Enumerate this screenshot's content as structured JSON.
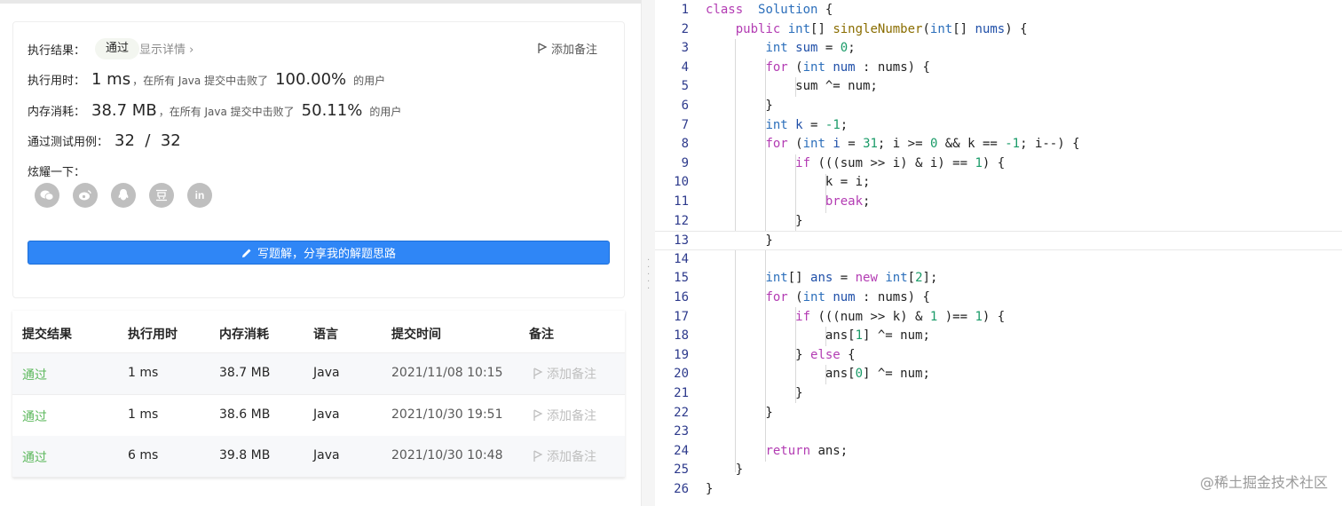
{
  "result": {
    "exec_result_label": "执行结果：",
    "status": "通过",
    "show_details": "显示详情 ›",
    "add_note": "添加备注",
    "time_label": "执行用时：",
    "time_value": "1 ms",
    "time_mid": "，在所有 Java 提交中击败了",
    "time_percent": "100.00%",
    "users_suffix": "的用户",
    "memory_label": "内存消耗：",
    "memory_value": "38.7 MB",
    "memory_mid": "，在所有 Java 提交中击败了",
    "memory_percent": "50.11%",
    "cases_label": "通过测试用例：",
    "cases_value": "32  /  32",
    "share_label": "炫耀一下：",
    "share_icons": [
      "wechat-icon",
      "weibo-icon",
      "qq-icon",
      "douban-icon",
      "linkedin-icon"
    ],
    "write_solution": "写题解，分享我的解题思路"
  },
  "submissions": {
    "headers": [
      "提交结果",
      "执行用时",
      "内存消耗",
      "语言",
      "提交时间",
      "备注"
    ],
    "rows": [
      {
        "status": "通过",
        "time": "1 ms",
        "memory": "38.7 MB",
        "lang": "Java",
        "submitted": "2021/11/08 10:15",
        "note": "添加备注"
      },
      {
        "status": "通过",
        "time": "1 ms",
        "memory": "38.6 MB",
        "lang": "Java",
        "submitted": "2021/10/30 19:51",
        "note": "添加备注"
      },
      {
        "status": "通过",
        "time": "6 ms",
        "memory": "39.8 MB",
        "lang": "Java",
        "submitted": "2021/10/30 10:48",
        "note": "添加备注"
      }
    ]
  },
  "editor": {
    "current_line": 13,
    "lines": [
      [
        [
          "kw",
          "class"
        ],
        [
          "",
          "  "
        ],
        [
          "cls",
          "Solution"
        ],
        [
          "",
          " {"
        ]
      ],
      [
        [
          "",
          "    "
        ],
        [
          "kw",
          "public"
        ],
        [
          "",
          " "
        ],
        [
          "ty",
          "int"
        ],
        [
          "",
          "[] "
        ],
        [
          "fn",
          "singleNumber"
        ],
        [
          "",
          "("
        ],
        [
          "ty",
          "int"
        ],
        [
          "",
          "[] "
        ],
        [
          "var",
          "nums"
        ],
        [
          "",
          ") {"
        ]
      ],
      [
        [
          "",
          "        "
        ],
        [
          "ty",
          "int"
        ],
        [
          "",
          " "
        ],
        [
          "var",
          "sum"
        ],
        [
          "",
          " = "
        ],
        [
          "num",
          "0"
        ],
        [
          "",
          ";"
        ]
      ],
      [
        [
          "",
          "        "
        ],
        [
          "kw",
          "for"
        ],
        [
          "",
          " ("
        ],
        [
          "ty",
          "int"
        ],
        [
          "",
          " "
        ],
        [
          "var",
          "num"
        ],
        [
          "",
          " : nums) {"
        ]
      ],
      [
        [
          "",
          "            sum ^= num;"
        ]
      ],
      [
        [
          "",
          "        }"
        ]
      ],
      [
        [
          "",
          "        "
        ],
        [
          "ty",
          "int"
        ],
        [
          "",
          " "
        ],
        [
          "var",
          "k"
        ],
        [
          "",
          " = "
        ],
        [
          "num",
          "-1"
        ],
        [
          "",
          ";"
        ]
      ],
      [
        [
          "",
          "        "
        ],
        [
          "kw",
          "for"
        ],
        [
          "",
          " ("
        ],
        [
          "ty",
          "int"
        ],
        [
          "",
          " "
        ],
        [
          "var",
          "i"
        ],
        [
          "",
          " = "
        ],
        [
          "num",
          "31"
        ],
        [
          "",
          "; i >= "
        ],
        [
          "num",
          "0"
        ],
        [
          "",
          " && k == "
        ],
        [
          "num",
          "-1"
        ],
        [
          "",
          "; i--) {"
        ]
      ],
      [
        [
          "",
          "            "
        ],
        [
          "kw",
          "if"
        ],
        [
          "",
          " (((sum >> i) & i) == "
        ],
        [
          "num",
          "1"
        ],
        [
          "",
          ") {"
        ]
      ],
      [
        [
          "",
          "                k = i;"
        ]
      ],
      [
        [
          "",
          "                "
        ],
        [
          "kw",
          "break"
        ],
        [
          "",
          ";"
        ]
      ],
      [
        [
          "",
          "            }"
        ]
      ],
      [
        [
          "",
          "        }"
        ]
      ],
      [
        [
          "",
          ""
        ]
      ],
      [
        [
          "",
          "        "
        ],
        [
          "ty",
          "int"
        ],
        [
          "",
          "[] "
        ],
        [
          "var",
          "ans"
        ],
        [
          "",
          " = "
        ],
        [
          "kw",
          "new"
        ],
        [
          "",
          " "
        ],
        [
          "ty",
          "int"
        ],
        [
          "",
          "["
        ],
        [
          "num",
          "2"
        ],
        [
          "",
          "];"
        ]
      ],
      [
        [
          "",
          "        "
        ],
        [
          "kw",
          "for"
        ],
        [
          "",
          " ("
        ],
        [
          "ty",
          "int"
        ],
        [
          "",
          " "
        ],
        [
          "var",
          "num"
        ],
        [
          "",
          " : nums) {"
        ]
      ],
      [
        [
          "",
          "            "
        ],
        [
          "kw",
          "if"
        ],
        [
          "",
          " (((num >> k) & "
        ],
        [
          "num",
          "1"
        ],
        [
          "",
          " )== "
        ],
        [
          "num",
          "1"
        ],
        [
          "",
          ") {"
        ]
      ],
      [
        [
          "",
          "                ans["
        ],
        [
          "num",
          "1"
        ],
        [
          "",
          "] ^= num;"
        ]
      ],
      [
        [
          "",
          "            } "
        ],
        [
          "kw",
          "else"
        ],
        [
          "",
          " {"
        ]
      ],
      [
        [
          "",
          "                ans["
        ],
        [
          "num",
          "0"
        ],
        [
          "",
          "] ^= num;"
        ]
      ],
      [
        [
          "",
          "            }"
        ]
      ],
      [
        [
          "",
          "        }"
        ]
      ],
      [
        [
          "",
          ""
        ]
      ],
      [
        [
          "",
          "        "
        ],
        [
          "kw",
          "return"
        ],
        [
          "",
          " ans;"
        ]
      ],
      [
        [
          "",
          "    }"
        ]
      ],
      [
        [
          "",
          "}"
        ]
      ]
    ]
  },
  "watermark": "@稀土掘金技术社区"
}
